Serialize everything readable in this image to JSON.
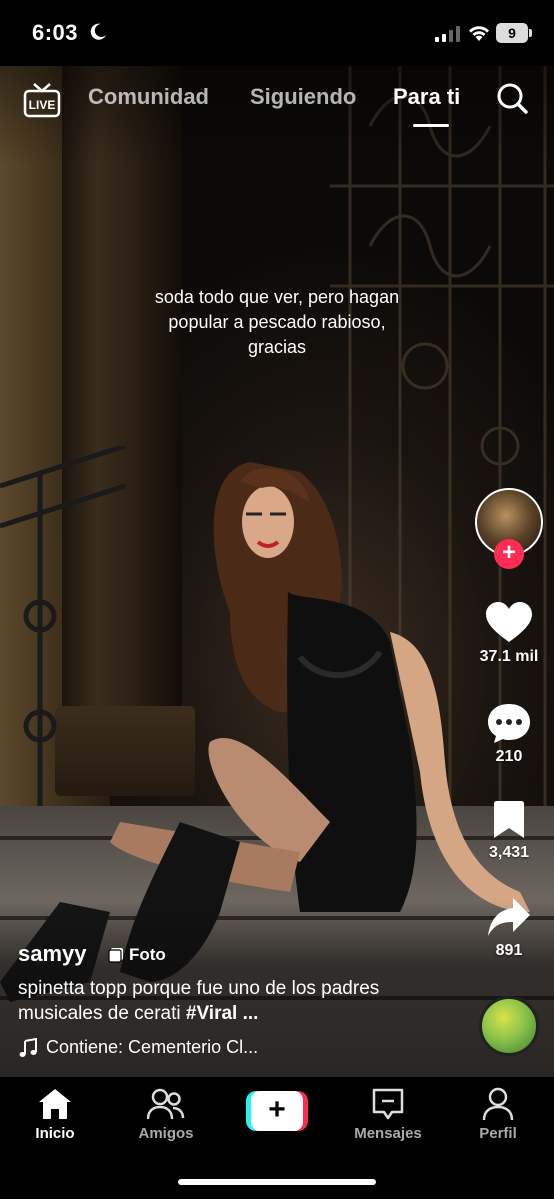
{
  "status_bar": {
    "time": "6:03",
    "battery_level": "9",
    "icons": [
      "moon-icon",
      "signal-icon",
      "wifi-icon",
      "battery-icon"
    ]
  },
  "top_nav": {
    "live_label": "LIVE",
    "tabs": [
      {
        "label": "Comunidad",
        "active": false
      },
      {
        "label": "Siguiendo",
        "active": false
      },
      {
        "label": "Para ti",
        "active": true
      }
    ]
  },
  "post": {
    "overlay_text": "soda todo que ver, pero hagan popular a pescado rabioso, gracias",
    "username": "samyy",
    "badge_label": "Foto",
    "description_text": "spinetta topp porque fue uno de los padres musicales de cerati ",
    "description_tag": "#Viral ...",
    "sound": "Contiene: Cementerio Cl..."
  },
  "actions": {
    "likes": "37.1 mil",
    "comments": "210",
    "saves": "3,431",
    "shares": "891"
  },
  "bottom_nav": {
    "items": [
      {
        "label": "Inicio",
        "icon": "home-icon",
        "active": true
      },
      {
        "label": "Amigos",
        "icon": "friends-icon",
        "active": false
      },
      {
        "label": "",
        "icon": "plus-icon",
        "active": false
      },
      {
        "label": "Mensajes",
        "icon": "inbox-icon",
        "active": false
      },
      {
        "label": "Perfil",
        "icon": "profile-icon",
        "active": false
      }
    ]
  },
  "colors": {
    "accent": "#fe2c55",
    "accent_secondary": "#25f4ee",
    "background": "#000000"
  }
}
